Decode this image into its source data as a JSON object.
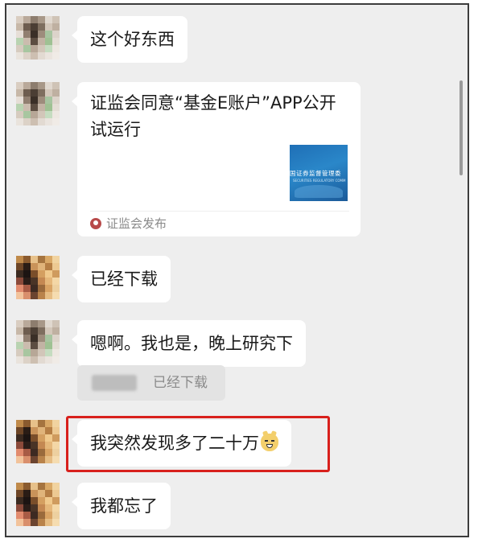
{
  "messages": [
    {
      "text": "这个好东西"
    },
    {
      "type": "card",
      "title": "证监会同意“基金E账户”APP公开试运行",
      "thumbnail_text": "国证券监督管理委",
      "thumbnail_subtext": "SECURITIES REGULATORY COMM",
      "source": "证监会发布"
    },
    {
      "text": "已经下载"
    },
    {
      "text": "嗯啊。我也是，晚上研究下",
      "quote": "已经下载"
    },
    {
      "text": "我突然发现多了二十万",
      "emoji": "doge-emoji",
      "highlighted": true
    },
    {
      "text": "我都忘了"
    }
  ],
  "colors": {
    "highlight": "#d8201c",
    "background": "#eeeeee",
    "bubble": "#ffffff"
  }
}
